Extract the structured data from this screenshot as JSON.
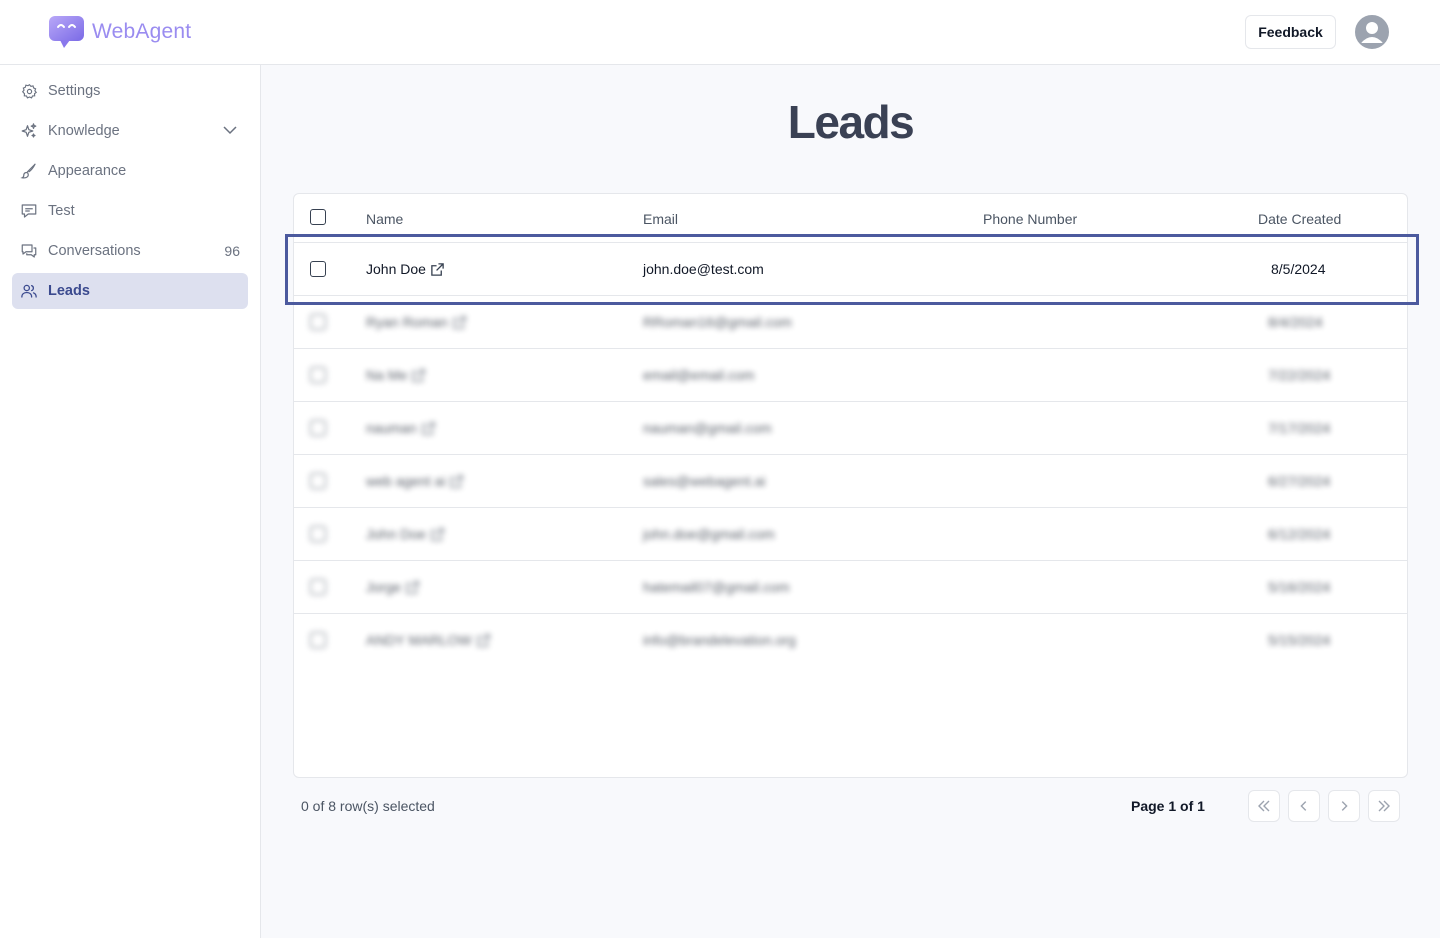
{
  "header": {
    "app_name": "WebAgent",
    "feedback_label": "Feedback"
  },
  "sidebar": {
    "items": [
      {
        "label": "Settings",
        "icon": "gear-icon"
      },
      {
        "label": "Knowledge",
        "icon": "sparkles-icon"
      },
      {
        "label": "Appearance",
        "icon": "brush-icon"
      },
      {
        "label": "Test",
        "icon": "chat-icon"
      },
      {
        "label": "Conversations",
        "icon": "conversations-icon",
        "count": "96"
      },
      {
        "label": "Leads",
        "icon": "users-icon",
        "active": true
      }
    ]
  },
  "main": {
    "title": "Leads",
    "table": {
      "columns": [
        "Name",
        "Email",
        "Phone Number",
        "Date Created"
      ],
      "rows": [
        {
          "name": "John Doe",
          "email": "john.doe@test.com",
          "phone": "",
          "date": "8/5/2024",
          "blurred": false
        },
        {
          "name": "Ryan Roman",
          "email": "RRoman16@gmail.com",
          "phone": "",
          "date": "8/4/2024",
          "blurred": true
        },
        {
          "name": "Na Me",
          "email": "email@email.com",
          "phone": "",
          "date": "7/22/2024",
          "blurred": true
        },
        {
          "name": "nauman",
          "email": "nauman@gmail.com",
          "phone": "",
          "date": "7/17/2024",
          "blurred": true
        },
        {
          "name": "web agent ai",
          "email": "sales@webagent.ai",
          "phone": "",
          "date": "6/27/2024",
          "blurred": true
        },
        {
          "name": "John Doe",
          "email": "john.doe@gmail.com",
          "phone": "",
          "date": "6/12/2024",
          "blurred": true
        },
        {
          "name": "Jorge",
          "email": "hatemail07@gmail.com",
          "phone": "",
          "date": "5/16/2024",
          "blurred": true
        },
        {
          "name": "ANDY MARLOW",
          "email": "info@brandelevation.org",
          "phone": "",
          "date": "5/15/2024",
          "blurred": true
        }
      ]
    },
    "selection_status": "0 of 8 row(s) selected",
    "page_info": "Page 1 of 1"
  },
  "colors": {
    "accent": "#9a8cf0",
    "active_nav_bg": "#dde0ef",
    "highlight_border": "#4c5a9e"
  }
}
